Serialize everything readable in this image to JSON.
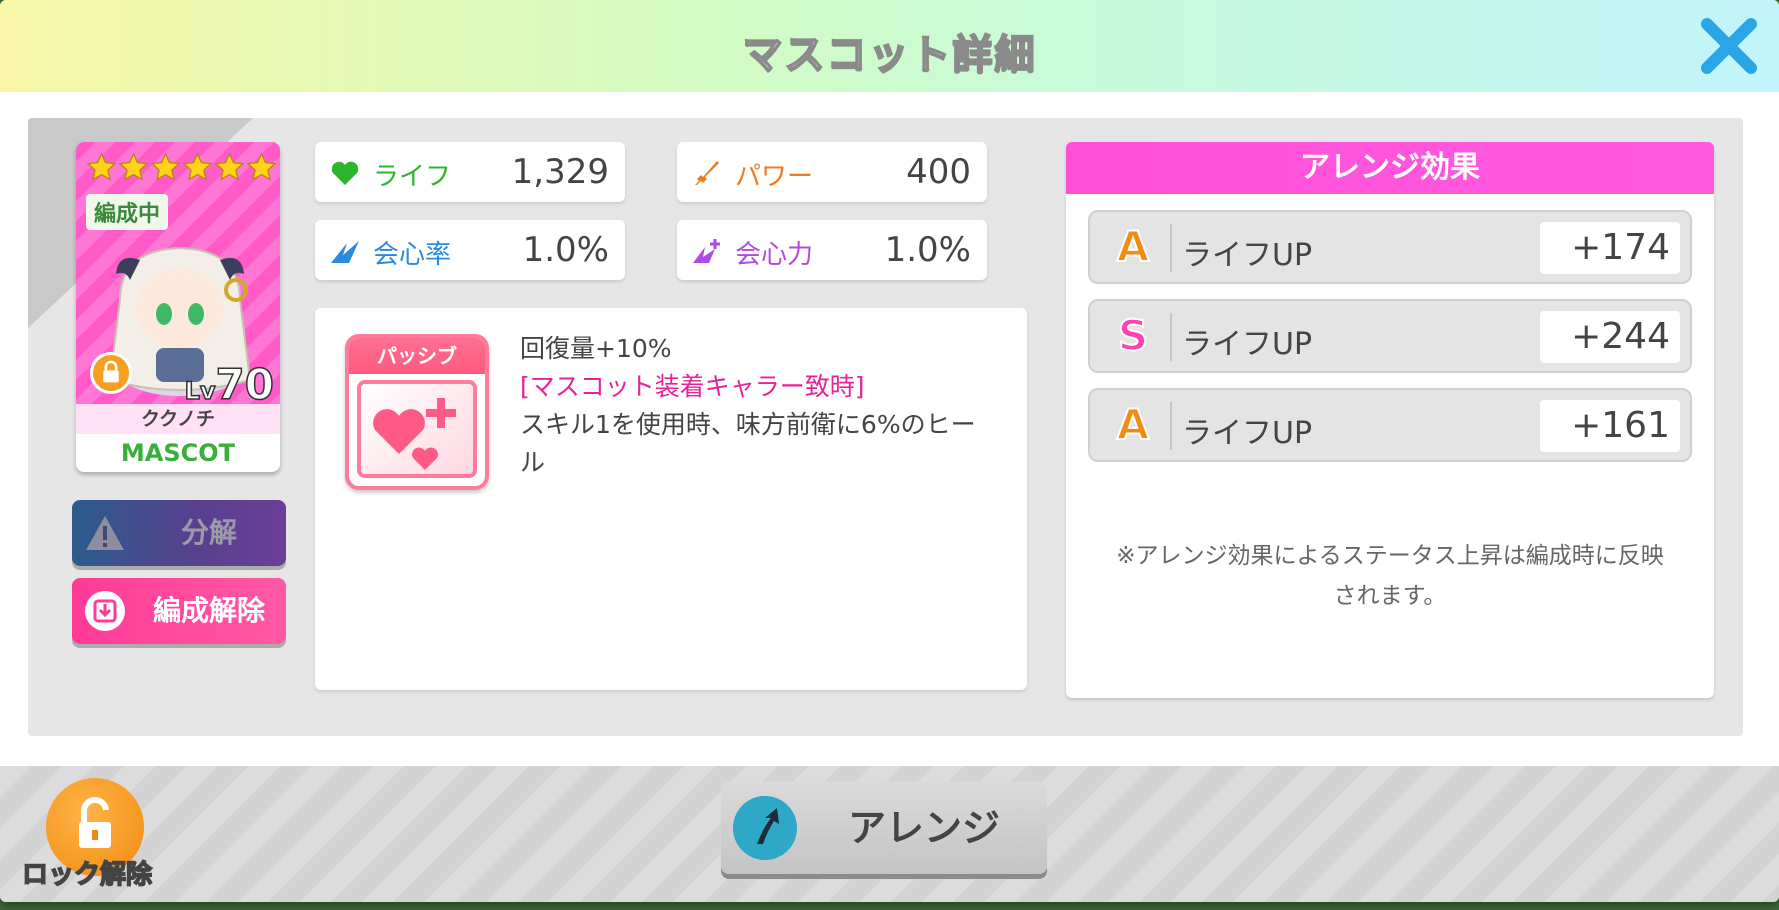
{
  "header": {
    "title": "マスコット詳細",
    "close_icon": "close-icon"
  },
  "mascot": {
    "stars": 6,
    "status_badge": "編成中",
    "level_label": "Lv",
    "level": "70",
    "name": "ククノチ",
    "type": "MASCOT"
  },
  "actions": {
    "dismantle": "分解",
    "unequip": "編成解除"
  },
  "stats": {
    "life": {
      "label": "ライフ",
      "value": "1,329",
      "color": "#2db52d"
    },
    "power": {
      "label": "パワー",
      "value": "400",
      "color": "#f07a20"
    },
    "crit_rate": {
      "label": "会心率",
      "value": "1.0%",
      "color": "#2a8ae0"
    },
    "crit_power": {
      "label": "会心力",
      "value": "1.0%",
      "color": "#b04ae0"
    }
  },
  "passive": {
    "badge": "パッシブ",
    "line1": "回復量+10%",
    "condition": "[マスコット装着キャラー致時]",
    "desc": "スキル1を使用時、味方前衛に6%のヒール"
  },
  "arrange": {
    "header": "アレンジ効果",
    "rows": [
      {
        "grade": "A",
        "label": "ライフUP",
        "value": "+174",
        "color": "#f58a10"
      },
      {
        "grade": "S",
        "label": "ライフUP",
        "value": "+244",
        "color": "#ff3fb3"
      },
      {
        "grade": "A",
        "label": "ライフUP",
        "value": "+161",
        "color": "#f58a10"
      }
    ],
    "note": "※アレンジ効果によるステータス上昇は編成時に反映されます。"
  },
  "footer": {
    "lock_release": "ロック解除",
    "arrange_button": "アレンジ"
  }
}
